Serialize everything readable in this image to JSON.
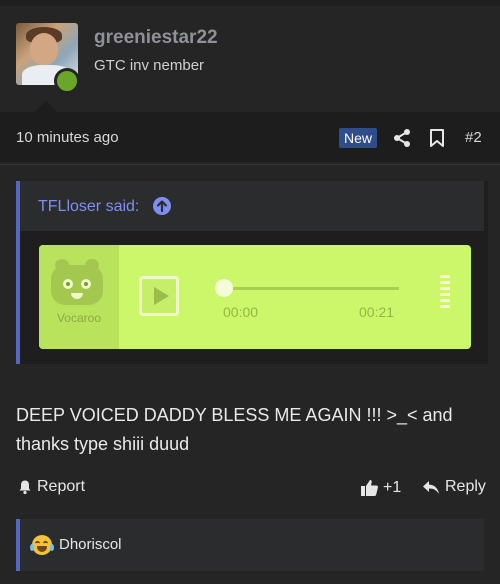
{
  "user": {
    "username": "greeniestar22",
    "title": "GTC inv nember",
    "online": true
  },
  "meta": {
    "timestamp": "10 minutes ago",
    "badge": "New",
    "post_number": "#2"
  },
  "quote": {
    "author": "TFLloser said:",
    "embed": {
      "brand": "Vocaroo",
      "time_start": "00:00",
      "time_end": "00:21",
      "progress": 0
    }
  },
  "post": {
    "text": "DEEP VOICED DADDY BLESS ME AGAIN !!! >_< and thanks type shiii duud"
  },
  "actions": {
    "report": "Report",
    "likes": "+1",
    "reply": "Reply"
  },
  "reactions": {
    "users": "Dhoriscol",
    "emoji": "joy-icon"
  },
  "colors": {
    "accent": "#5567c4",
    "quote_author": "#7e8ff0",
    "badge": "#2f4d8a",
    "online": "#6aa629",
    "vocaroo": "#cdf76a"
  }
}
